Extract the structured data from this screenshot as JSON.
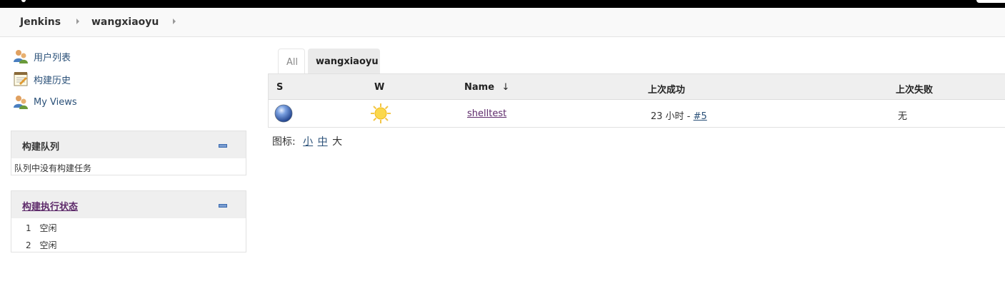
{
  "breadcrumb": {
    "root": "Jenkins",
    "user": "wangxiaoyu"
  },
  "sidebar": {
    "links": [
      {
        "label": "用户列表",
        "icon": "users-icon"
      },
      {
        "label": "构建历史",
        "icon": "notepad-icon"
      },
      {
        "label": "My Views",
        "icon": "users-icon"
      }
    ]
  },
  "build_queue": {
    "title": "构建队列",
    "empty_text": "队列中没有构建任务"
  },
  "executors": {
    "title": "构建执行状态",
    "items": [
      {
        "num": "1",
        "status": "空闲"
      },
      {
        "num": "2",
        "status": "空闲"
      }
    ]
  },
  "tabs": {
    "all": "All",
    "active": "wangxiaoyu"
  },
  "table": {
    "headers": {
      "s": "S",
      "w": "W",
      "name": "Name",
      "sort_arrow": "↓",
      "last_success": "上次成功",
      "last_failure": "上次失败"
    },
    "rows": [
      {
        "status_icon": "blue-ball-icon",
        "weather_icon": "sun-icon",
        "name": "shelltest",
        "last_success_time": "23 小时 - ",
        "last_success_build": "#5",
        "last_failure": "无"
      }
    ]
  },
  "icon_legend": {
    "label": "图标:",
    "small": "小",
    "medium": "中",
    "large": "大"
  },
  "colors": {
    "link": "#2a5078",
    "visited_link": "#5d2a6a",
    "header_bg": "#efefef"
  }
}
